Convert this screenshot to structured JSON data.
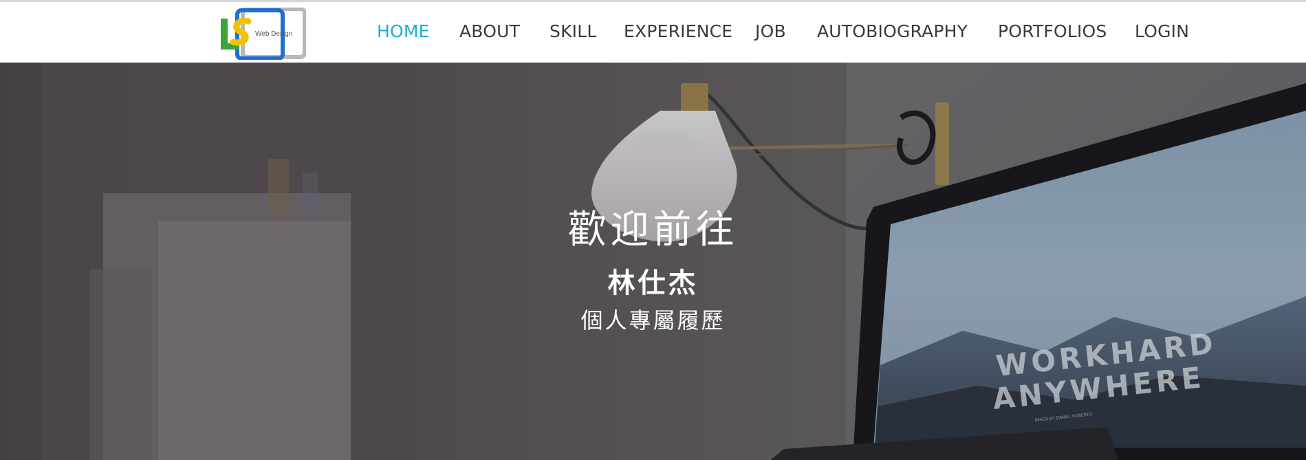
{
  "header": {
    "logo_text": "Web Design",
    "logo_letters": "LS",
    "nav": [
      {
        "label": "HOME",
        "active": true
      },
      {
        "label": "ABOUT",
        "active": false
      },
      {
        "label": "SKILL",
        "active": false
      },
      {
        "label": "EXPERIENCE",
        "active": false
      },
      {
        "label": "JOB",
        "active": false
      },
      {
        "label": "AUTOBIOGRAPHY",
        "active": false
      },
      {
        "label": "PORTFOLIOS",
        "active": false
      },
      {
        "label": "LOGIN",
        "active": false
      }
    ]
  },
  "hero": {
    "title": "歡迎前往",
    "name": "林仕杰",
    "subtitle": "個人專屬履歷",
    "screen_text_line1": "WORKHARD",
    "screen_text_line2": "ANYWHERE",
    "screen_credit": "IMAGE BY DANIEL ROBERTO"
  },
  "colors": {
    "accent": "#1ab0cf",
    "nav_text": "#3a3a3a",
    "hero_overlay": "#5d5a5d"
  }
}
